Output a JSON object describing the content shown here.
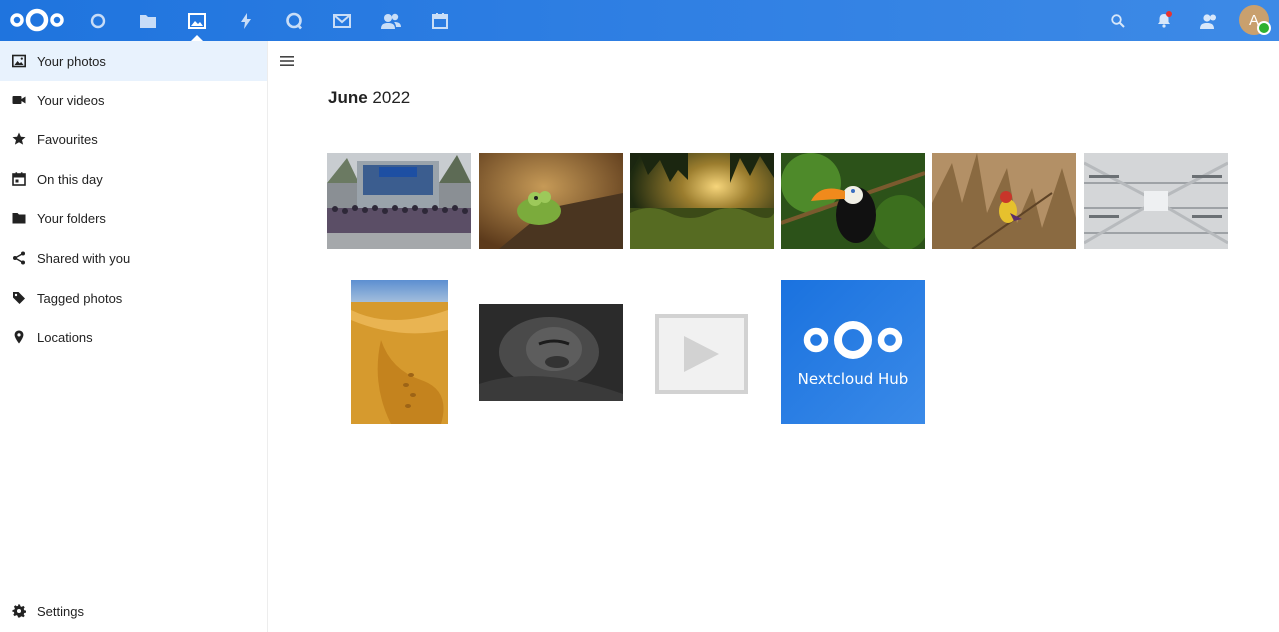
{
  "header": {
    "apps": [
      {
        "name": "dashboard-icon"
      },
      {
        "name": "files-icon"
      },
      {
        "name": "photos-icon",
        "active": true
      },
      {
        "name": "activity-icon"
      },
      {
        "name": "talk-icon"
      },
      {
        "name": "mail-icon"
      },
      {
        "name": "contacts-icon"
      },
      {
        "name": "calendar-icon"
      }
    ],
    "avatar_initial": "A",
    "accent": "#2f7fe3"
  },
  "sidebar": {
    "items": [
      {
        "label": "Your photos",
        "icon": "image-icon",
        "active": true
      },
      {
        "label": "Your videos",
        "icon": "video-icon"
      },
      {
        "label": "Favourites",
        "icon": "star-icon"
      },
      {
        "label": "On this day",
        "icon": "calendar-today-icon"
      },
      {
        "label": "Your folders",
        "icon": "folder-icon"
      },
      {
        "label": "Shared with you",
        "icon": "share-icon"
      },
      {
        "label": "Tagged photos",
        "icon": "tag-icon"
      },
      {
        "label": "Locations",
        "icon": "map-marker-icon"
      }
    ],
    "settings_label": "Settings"
  },
  "main": {
    "month": "June",
    "year": "2022",
    "tiles": [
      {
        "name": "photo-group-event"
      },
      {
        "name": "photo-frog"
      },
      {
        "name": "photo-sunset-field"
      },
      {
        "name": "photo-toucan"
      },
      {
        "name": "photo-finch"
      },
      {
        "name": "photo-library"
      },
      {
        "name": "photo-desert"
      },
      {
        "name": "photo-gorilla"
      },
      {
        "name": "video-placeholder"
      },
      {
        "name": "nextcloud-hub-image",
        "caption": "Nextcloud Hub"
      }
    ]
  }
}
